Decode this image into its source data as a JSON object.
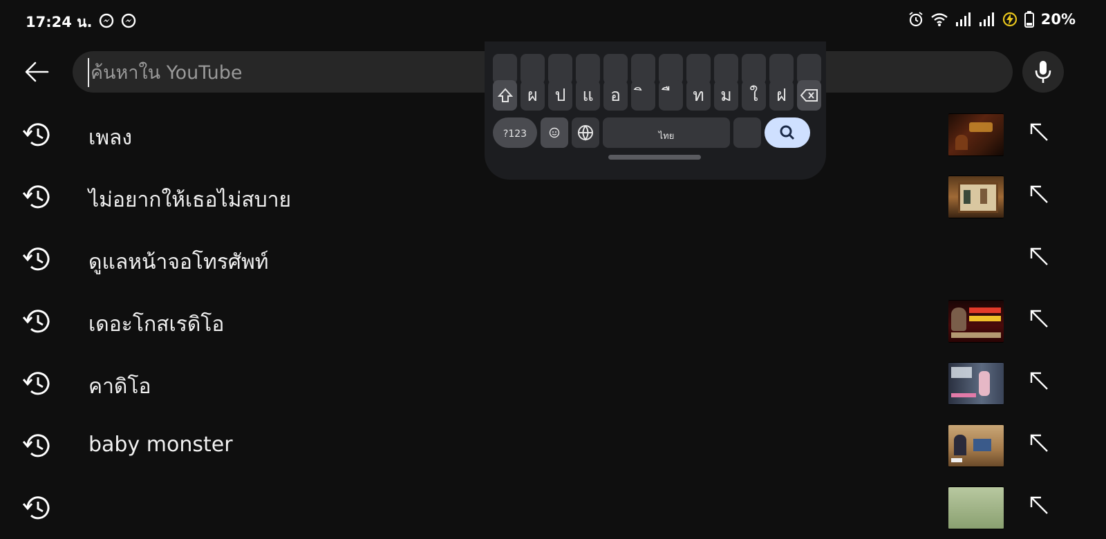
{
  "status_bar": {
    "time": "17:24 น.",
    "battery": "20%",
    "icons": [
      "messenger-icon",
      "messenger-icon",
      "alarm-icon",
      "wifi-icon",
      "signal-icon",
      "signal-icon",
      "charging-icon",
      "battery-icon"
    ]
  },
  "search": {
    "placeholder": "ค้นหาใน YouTube",
    "value": ""
  },
  "keyboard": {
    "row2": [
      "ผ",
      "ป",
      "แ",
      "อ",
      "ิ",
      "ื",
      "ท",
      "ม",
      "ใ",
      "ฝ"
    ],
    "row3_left": "?123",
    "space_label": "ไทย"
  },
  "history": [
    {
      "text": "เพลง",
      "has_thumb": true
    },
    {
      "text": "ไม่อยากให้เธอไม่สบาย",
      "has_thumb": true
    },
    {
      "text": "ดูแลหน้าจอโทรศัพท์",
      "has_thumb": false
    },
    {
      "text": "เดอะโกสเรดิโอ",
      "has_thumb": true
    },
    {
      "text": "คาดิโอ",
      "has_thumb": true
    },
    {
      "text": "baby monster",
      "has_thumb": true
    },
    {
      "text": "",
      "has_thumb": true
    }
  ],
  "colors": {
    "background": "#0f0f0f",
    "search_bg": "#272727",
    "text": "#f1f1f1",
    "keyboard_bg": "#1c1d20",
    "key_bg": "#36373b",
    "search_key": "#cfe0ff"
  }
}
